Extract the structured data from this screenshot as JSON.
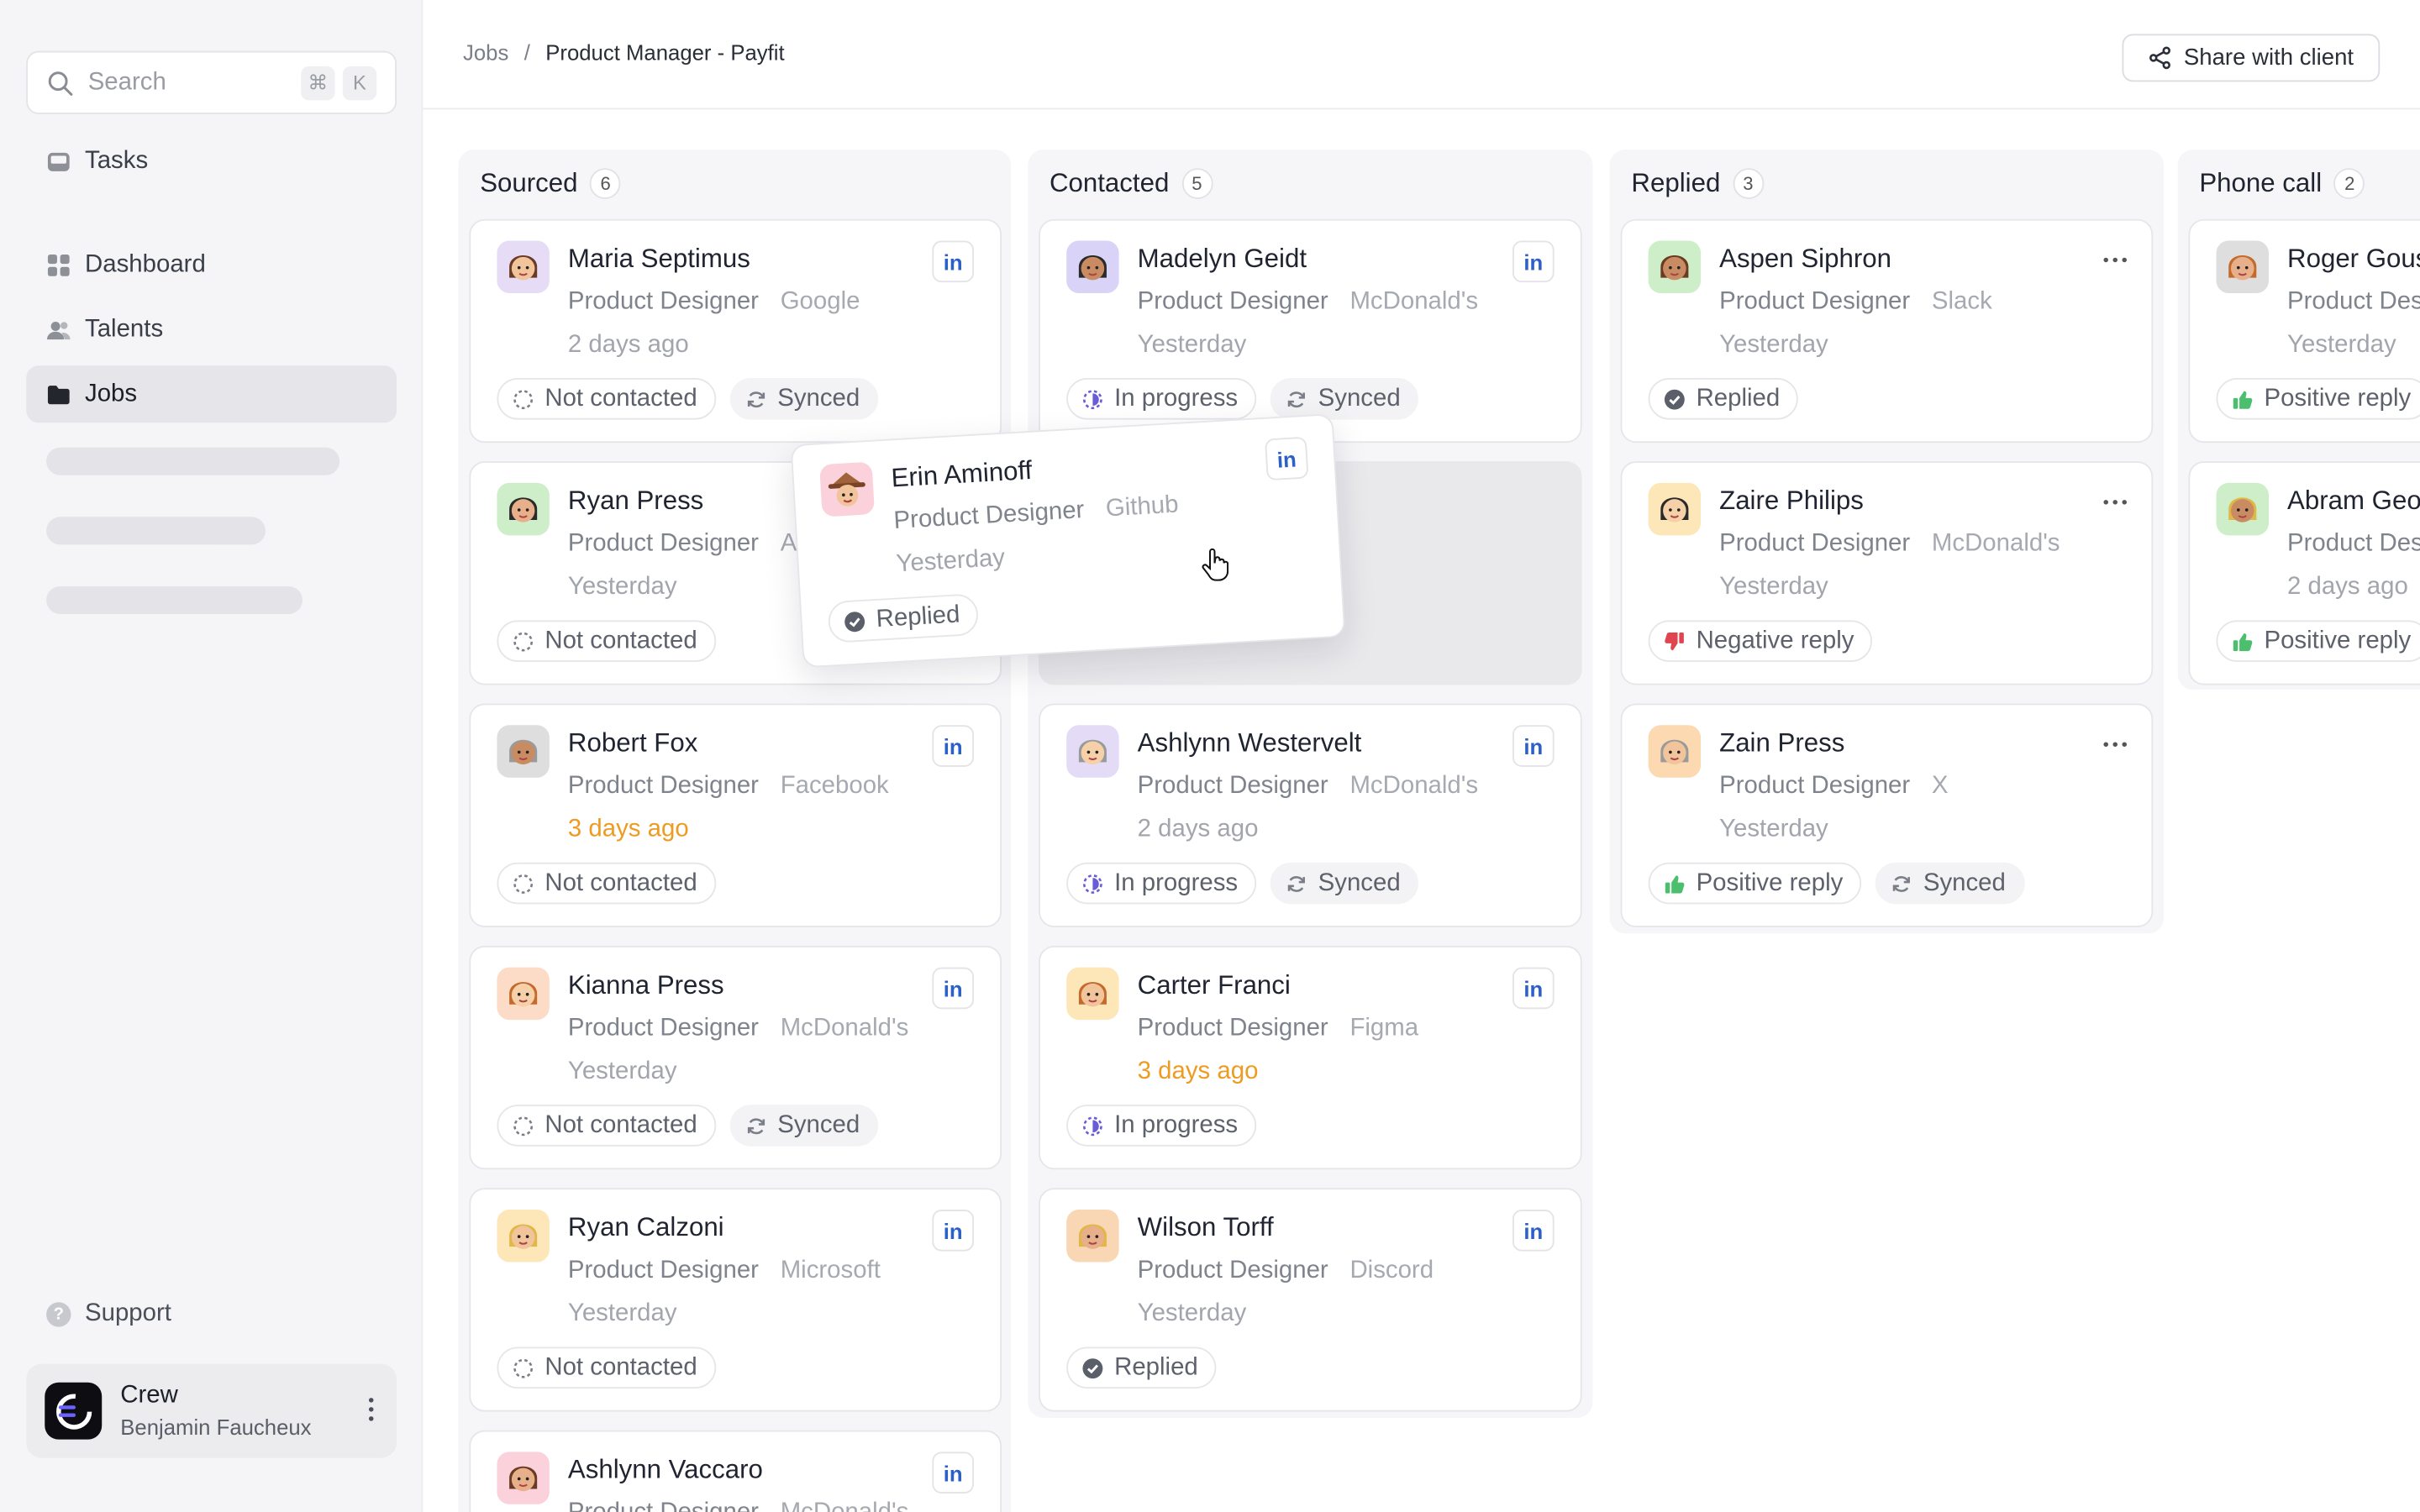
{
  "sidebar": {
    "search_placeholder": "Search",
    "shortcut_cmd": "⌘",
    "shortcut_key": "K",
    "nav": [
      {
        "label": "Tasks",
        "icon": "inbox-icon"
      },
      {
        "label": "Dashboard",
        "icon": "grid-icon"
      },
      {
        "label": "Talents",
        "icon": "users-icon"
      },
      {
        "label": "Jobs",
        "icon": "folder-icon",
        "active": true
      }
    ],
    "support_label": "Support",
    "account": {
      "org": "Crew",
      "user": "Benjamin Faucheux"
    }
  },
  "header": {
    "crumb_root": "Jobs",
    "crumb_sep": "/",
    "crumb_current": "Product Manager - Payfit",
    "share_label": "Share with client"
  },
  "columns": [
    {
      "title": "Sourced",
      "count": "6",
      "cards": [
        {
          "name": "Maria Septimus",
          "role": "Product Designer",
          "company": "Google",
          "time": "2 days ago",
          "tags": [
            "Not contacted",
            "Synced"
          ]
        },
        {
          "name": "Ryan Press",
          "role": "Product Designer",
          "company": "A",
          "time": "Yesterday",
          "tags": [
            "Not contacted"
          ]
        },
        {
          "name": "Robert Fox",
          "role": "Product Designer",
          "company": "Facebook",
          "time": "3 days ago",
          "tags": [
            "Not contacted"
          ]
        },
        {
          "name": "Kianna Press",
          "role": "Product Designer",
          "company": "McDonald's",
          "time": "Yesterday",
          "tags": [
            "Not contacted",
            "Synced"
          ]
        },
        {
          "name": "Ryan Calzoni",
          "role": "Product Designer",
          "company": "Microsoft",
          "time": "Yesterday",
          "tags": [
            "Not contacted"
          ]
        },
        {
          "name": "Ashlynn Vaccaro",
          "role": "Product Designer",
          "company": "McDonald's"
        }
      ]
    },
    {
      "title": "Contacted",
      "count": "5",
      "cards": [
        {
          "name": "Madelyn Geidt",
          "role": "Product Designer",
          "company": "McDonald's",
          "time": "Yesterday",
          "tags": [
            "In progress",
            "Synced"
          ]
        },
        {
          "name": "Ashlynn Westervelt",
          "role": "Product Designer",
          "company": "McDonald's",
          "time": "2 days ago",
          "tags": [
            "In progress",
            "Synced"
          ]
        },
        {
          "name": "Carter Franci",
          "role": "Product Designer",
          "company": "Figma",
          "time": "3 days ago",
          "tags": [
            "In progress"
          ]
        },
        {
          "name": "Wilson Torff",
          "role": "Product Designer",
          "company": "Discord",
          "time": "Yesterday",
          "tags": [
            "Replied"
          ]
        }
      ]
    },
    {
      "title": "Replied",
      "count": "3",
      "cards": [
        {
          "name": "Aspen Siphron",
          "role": "Product Designer",
          "company": "Slack",
          "time": "Yesterday",
          "tags": [
            "Replied"
          ]
        },
        {
          "name": "Zaire Philips",
          "role": "Product Designer",
          "company": "McDonald's",
          "time": "Yesterday",
          "tags": [
            "Negative reply"
          ]
        },
        {
          "name": "Zain Press",
          "role": "Product Designer",
          "company": "X",
          "time": "Yesterday",
          "tags": [
            "Positive reply",
            "Synced"
          ]
        }
      ]
    },
    {
      "title": "Phone call",
      "count": "2",
      "cards": [
        {
          "name": "Roger Gous",
          "role": "Product Des",
          "company": "",
          "time": "Yesterday",
          "tags": [
            "Positive reply"
          ]
        },
        {
          "name": "Abram Geo",
          "role": "Product Des",
          "company": "",
          "time": "2 days ago",
          "tags": [
            "Positive reply"
          ]
        }
      ]
    }
  ],
  "dragging_card": {
    "name": "Erin Aminoff",
    "role": "Product Designer",
    "company": "Github",
    "time": "Yesterday",
    "tags": [
      "Replied"
    ]
  },
  "linkedin_label": "in",
  "colors": {
    "accent_linkedin": "#2b5fc9",
    "warn_time": "#ee9b22",
    "positive": "#4cbf6e",
    "negative": "#e0454f",
    "progress": "#6a5bd6"
  }
}
